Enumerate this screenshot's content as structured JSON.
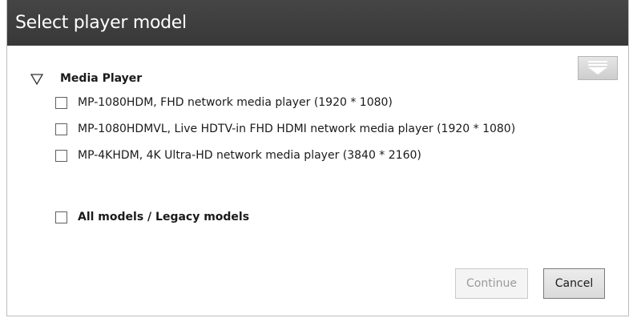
{
  "dialog": {
    "title": "Select player model",
    "menu_icon": "dropdown-menu-icon",
    "group": {
      "label": "Media Player",
      "expanded": true,
      "toggle_icon": "triangle-down-icon",
      "items": [
        {
          "label": "MP-1080HDM, FHD network media player (1920 * 1080)",
          "checked": false
        },
        {
          "label": "MP-1080HDMVL, Live HDTV-in FHD HDMI network media player (1920 * 1080)",
          "checked": false
        },
        {
          "label": "MP-4KHDM, 4K Ultra-HD network media player (3840 * 2160)",
          "checked": false
        }
      ]
    },
    "all_models": {
      "label": "All models / Legacy models",
      "checked": false
    },
    "buttons": {
      "continue_label": "Continue",
      "continue_enabled": false,
      "cancel_label": "Cancel"
    },
    "colors": {
      "titlebar": "#3c3c3c",
      "title_text": "#ffffff",
      "disabled_text": "#9a9a9a"
    }
  }
}
